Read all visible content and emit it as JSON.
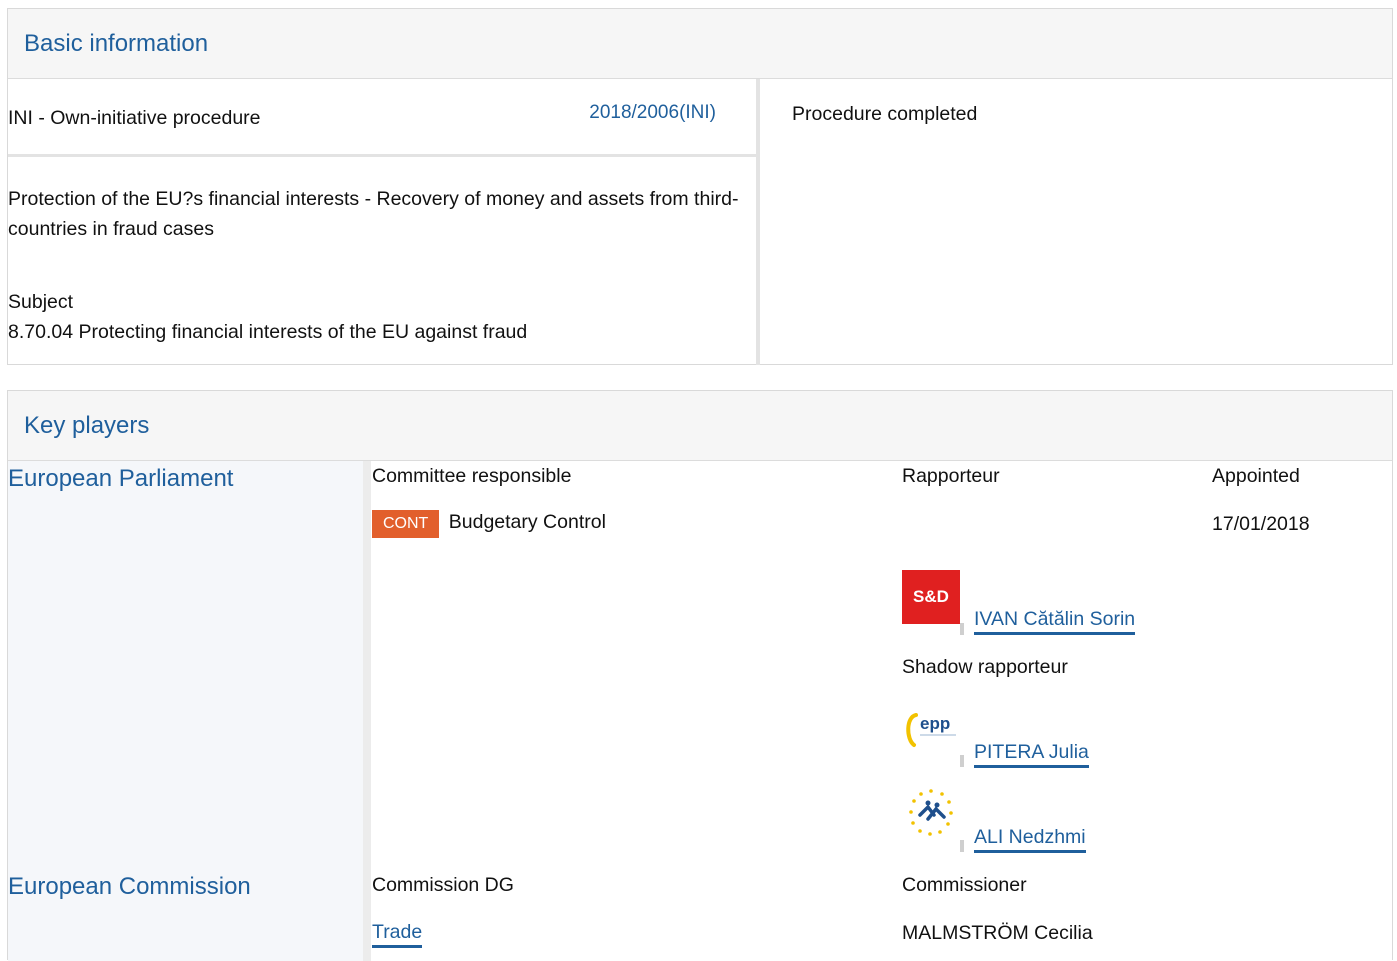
{
  "basic": {
    "header": "Basic information",
    "procedure_type": "INI - Own-initiative procedure",
    "procedure_ref": "2018/2006(INI)",
    "status": "Procedure completed",
    "title": "Protection of the EU?s financial interests - Recovery of money and assets from third-countries in fraud cases",
    "subject_label": "Subject",
    "subject_value": "8.70.04 Protecting financial interests of the EU against fraud"
  },
  "players": {
    "header": "Key players",
    "parliament": {
      "label": "European Parliament",
      "col_committee": "Committee responsible",
      "col_rapporteur": "Rapporteur",
      "col_appointed": "Appointed",
      "committee_code": "CONT",
      "committee_name": "Budgetary Control",
      "appointed_date": "17/01/2018",
      "rapporteur_logo_text": "S&D",
      "rapporteur_name": "IVAN Cătălin Sorin",
      "shadow_label": "Shadow rapporteur",
      "shadows": [
        {
          "logo": "epp-logo",
          "logo_text": "epp",
          "name": "PITERA Julia"
        },
        {
          "logo": "alde-logo",
          "name": "ALI Nedzhmi"
        }
      ]
    },
    "commission": {
      "label": "European Commission",
      "col_dg": "Commission DG",
      "col_commissioner": "Commissioner",
      "dg_name": "Trade",
      "commissioner_name": "MALMSTRÖM Cecilia"
    }
  },
  "colors": {
    "link": "#1f5f9c",
    "badge": "#e25f2c",
    "sd_red": "#e02020"
  }
}
